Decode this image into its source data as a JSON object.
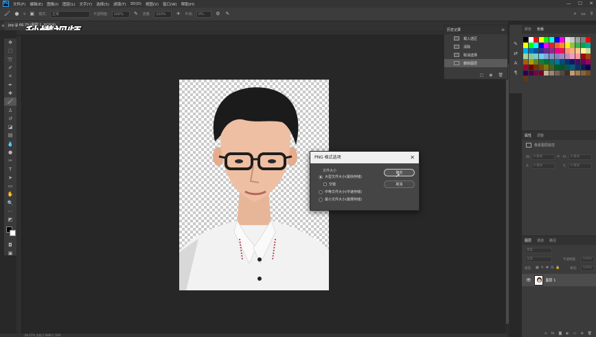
{
  "menubar": {
    "logo": "Ps",
    "items": [
      "文件(F)",
      "编辑(E)",
      "图像(I)",
      "图层(L)",
      "文字(Y)",
      "选择(S)",
      "滤镜(T)",
      "3D(D)",
      "视图(V)",
      "窗口(W)",
      "帮助(H)"
    ],
    "window_controls": [
      "—",
      "☐",
      "✕"
    ]
  },
  "options": {
    "mode_label": "模式:",
    "mode_value": "正常",
    "opacity_label": "不透明度:",
    "opacity_value": "100%",
    "flow_label": "流量:",
    "flow_value": "100%",
    "smooth_label": "平滑:",
    "smooth_value": "0%",
    "brush_size": "9"
  },
  "document": {
    "tab_label": "jpg @ 66.7%(图层 1, RGB/8)",
    "status": "66.67%    文档:1.98M/1.76M"
  },
  "watermark": "秒懂视频",
  "history": {
    "tabs": [
      "历史记录"
    ],
    "items": [
      {
        "label": "载入选区",
        "selected": false
      },
      {
        "label": "清除",
        "selected": false
      },
      {
        "label": "取消选择",
        "selected": false
      },
      {
        "label": "删除图层",
        "selected": true
      }
    ]
  },
  "swatches_panel": {
    "tabs": [
      "颜色",
      "色板"
    ],
    "colors": [
      "#000000",
      "#ffffff",
      "#ff0000",
      "#ffff00",
      "#00ff00",
      "#00ffff",
      "#0000ff",
      "#ff00ff",
      "#e1e1e1",
      "#c8c8c8",
      "#a0a0a0",
      "#808080",
      "#ff0000",
      "#ffff00",
      "#00ff00",
      "#00ffff",
      "#0000ff",
      "#ff00ff",
      "#ed1c24",
      "#f26522",
      "#f7941d",
      "#fff200",
      "#8dc63f",
      "#39b54a",
      "#00a651",
      "#00a99d",
      "#00aeef",
      "#0072bc",
      "#0054a6",
      "#2e3192",
      "#662d91",
      "#92278f",
      "#ec008c",
      "#ed145b",
      "#f69679",
      "#f9ad81",
      "#fdc689",
      "#fff799",
      "#c4df9b",
      "#a3d39c",
      "#82ca9c",
      "#7accc8",
      "#6dcff6",
      "#7da7d9",
      "#8393ca",
      "#8781bd",
      "#a186be",
      "#bd8cbf",
      "#f49ac1",
      "#f5989d",
      "#9e0b0f",
      "#a0410d",
      "#a36209",
      "#aba000",
      "#598527",
      "#1a7b30",
      "#007236",
      "#00746b",
      "#0076a3",
      "#004b80",
      "#003471",
      "#1b1464",
      "#440e62",
      "#630460",
      "#9e005d",
      "#9e0039",
      "#790000",
      "#7b2e00",
      "#7d4900",
      "#827b00",
      "#406618",
      "#005e20",
      "#005826",
      "#005952",
      "#005b7f",
      "#003663",
      "#002157",
      "#0d004c",
      "#32004b",
      "#4b0049",
      "#7b0046",
      "#7a0026",
      "#c7b299",
      "#998675",
      "#736357",
      "#534741",
      "#37302a",
      "#c69c6d",
      "#a67c52",
      "#8c6239",
      "#754c24",
      "#603913"
    ]
  },
  "properties": {
    "tabs": [
      "属性",
      "调整"
    ],
    "section": "像素图层属性",
    "w_label": "W:",
    "w_value": "0 厘米",
    "h_label": "H:",
    "h_value": "0 厘米",
    "x_label": "X:",
    "x_value": "0 厘米",
    "y_label": "Y:",
    "y_value": "0 厘米"
  },
  "layers": {
    "tabs": [
      "图层",
      "通道",
      "路径"
    ],
    "filter_label": "类型",
    "blend_mode": "正常",
    "opacity_label": "不透明度:",
    "opacity_value": "100%",
    "lock_label": "锁定:",
    "fill_label": "填充:",
    "fill_value": "100%",
    "layer_name": "图层 1"
  },
  "dialog": {
    "title": "PNG 格式选项",
    "group_label": "文件大小",
    "options": [
      {
        "label": "大型文件大小(最快存储)",
        "checked": true
      },
      {
        "label": "交错",
        "checked": false
      },
      {
        "label": "中等文件大小(中速存储)",
        "checked": false
      },
      {
        "label": "最小文件大小(最慢存储)",
        "checked": false
      }
    ],
    "ok_label": "确定",
    "cancel_label": "取消",
    "close_symbol": "✕"
  }
}
